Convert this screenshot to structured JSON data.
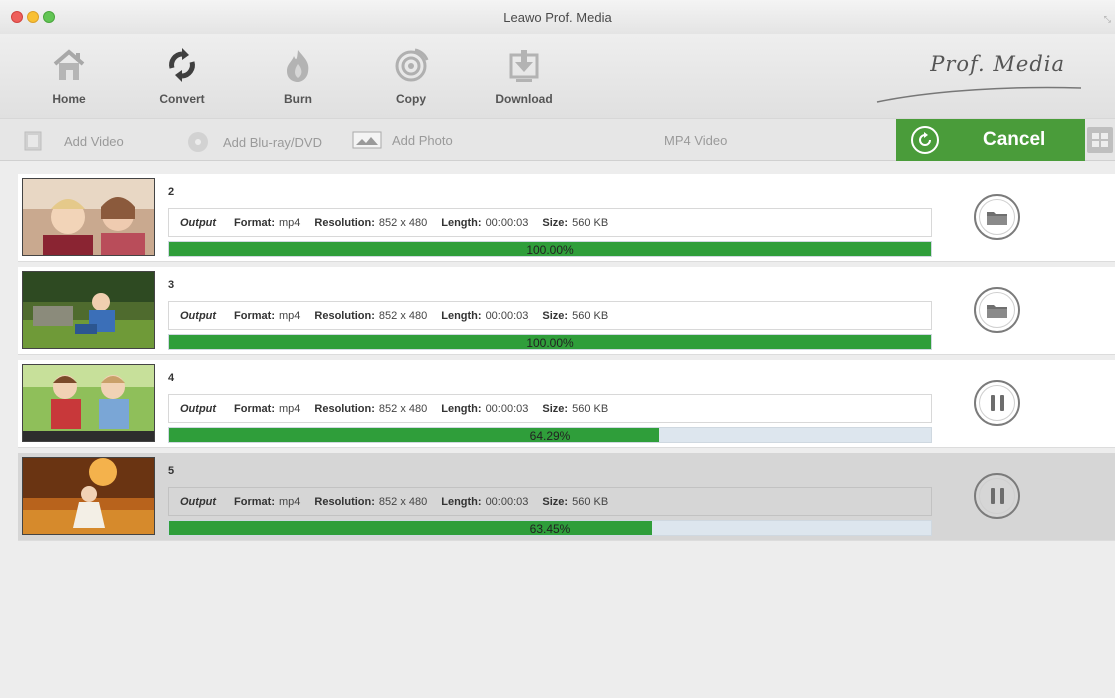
{
  "window": {
    "title": "Leawo Prof. Media"
  },
  "toolbar": {
    "items": [
      {
        "label": "Home",
        "icon": "home-icon"
      },
      {
        "label": "Convert",
        "icon": "convert-icon"
      },
      {
        "label": "Burn",
        "icon": "burn-icon"
      },
      {
        "label": "Copy",
        "icon": "copy-icon"
      },
      {
        "label": "Download",
        "icon": "download-icon"
      }
    ],
    "brand": "Prof. Media"
  },
  "subbar": {
    "add_video": "Add Video",
    "add_bluray": "Add Blu-ray/DVD",
    "add_photo": "Add Photo",
    "profile": "MP4 Video",
    "cancel": "Cancel"
  },
  "labels": {
    "output": "Output",
    "format": "Format:",
    "resolution": "Resolution:",
    "length": "Length:",
    "size": "Size:"
  },
  "tasks": [
    {
      "title": "2",
      "format": "mp4",
      "resolution": "852 x 480",
      "length": "00:00:03",
      "size": "560 KB",
      "progress": 100.0,
      "progress_text": "100.00%",
      "action": "open-folder"
    },
    {
      "title": "3",
      "format": "mp4",
      "resolution": "852 x 480",
      "length": "00:00:03",
      "size": "560 KB",
      "progress": 100.0,
      "progress_text": "100.00%",
      "action": "open-folder"
    },
    {
      "title": "4",
      "format": "mp4",
      "resolution": "852 x 480",
      "length": "00:00:03",
      "size": "560 KB",
      "progress": 64.29,
      "progress_text": "64.29%",
      "action": "pause"
    },
    {
      "title": "5",
      "format": "mp4",
      "resolution": "852 x 480",
      "length": "00:00:03",
      "size": "560 KB",
      "progress": 63.45,
      "progress_text": "63.45%",
      "action": "pause",
      "selected": true
    }
  ],
  "colors": {
    "accent_green": "#4a9c3a",
    "progress_green": "#2f9e3a"
  }
}
